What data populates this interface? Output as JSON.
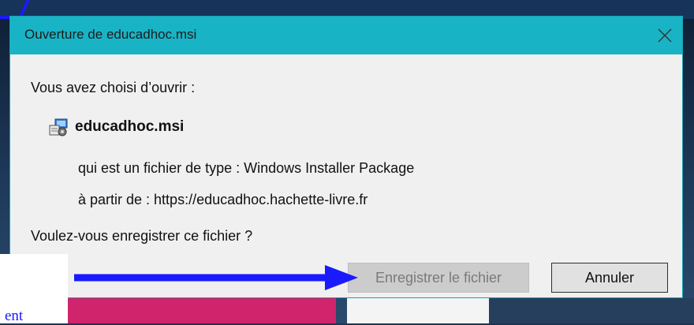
{
  "dialog": {
    "title": "Ouverture de educadhoc.msi",
    "intro": "Vous avez choisi d’ouvrir :",
    "file_name": "educadhoc.msi",
    "type_line": "qui est un fichier de type : Windows Installer Package",
    "from_line": "à partir de : https://educadhoc.hachette-livre.fr",
    "question": "Voulez-vous enregistrer ce fichier ?",
    "save_label": "Enregistrer le fichier",
    "cancel_label": "Annuler"
  },
  "annotation": {
    "text_fragment": "ent"
  },
  "colors": {
    "titlebar": "#19b3c6",
    "arrow": "#1a1aff"
  }
}
